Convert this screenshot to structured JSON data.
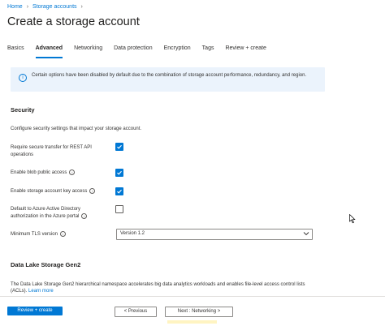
{
  "breadcrumb": {
    "home": "Home",
    "storage_accounts": "Storage accounts"
  },
  "page": {
    "title": "Create a storage account",
    "more": "···"
  },
  "tabs": [
    {
      "label": "Basics"
    },
    {
      "label": "Advanced"
    },
    {
      "label": "Networking"
    },
    {
      "label": "Data protection"
    },
    {
      "label": "Encryption"
    },
    {
      "label": "Tags"
    },
    {
      "label": "Review + create"
    }
  ],
  "info": {
    "icon": "info-icon",
    "text": "Certain options have been disabled by default due to the combination of storage account performance, redundancy, and region."
  },
  "security": {
    "title": "Security",
    "description": "Configure security settings that impact your storage account.",
    "options": [
      {
        "label": "Require secure transfer for REST API operations",
        "checked": true
      },
      {
        "label": "Enable blob public access",
        "checked": true
      },
      {
        "label": "Enable storage account key access",
        "checked": true
      },
      {
        "label": "Default to Azure Active Directory authorization in the Azure portal",
        "checked": false
      }
    ],
    "tls_label": "Minimum TLS version",
    "tls_value": "Version 1.2"
  },
  "data_lake": {
    "title": "Data Lake Storage Gen2",
    "description": "The Data Lake Storage Gen2 hierarchical namespace accelerates big data analytics workloads and enables file-level access control lists (ACLs).",
    "learn_more": "Learn more"
  },
  "footer": {
    "review_create": "Review + create",
    "previous": "< Previous",
    "next": "Next : Networking >"
  },
  "colors": {
    "accent": "#0078d4",
    "info_bg": "#ebf3fc"
  }
}
